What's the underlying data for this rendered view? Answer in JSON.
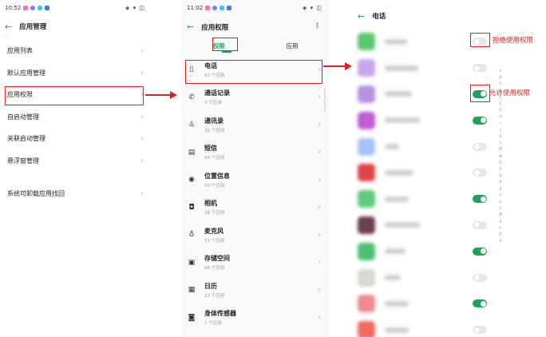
{
  "panel1": {
    "status": {
      "time": "10:52",
      "right": "◈ ▾ ◫"
    },
    "title": "应用管理",
    "menu": [
      {
        "label": "应用列表"
      },
      {
        "label": "默认应用管理"
      },
      {
        "label": "应用权限"
      },
      {
        "label": "自启动管理"
      },
      {
        "label": "关联启动管理"
      },
      {
        "label": "悬浮窗管理"
      },
      {
        "label": "系统可卸载应用找回"
      }
    ]
  },
  "panel2": {
    "status": {
      "time": "11:02",
      "right": "◈ ▾ ◫"
    },
    "title": "应用权限",
    "tabs": [
      "权限",
      "应用"
    ],
    "permissions": [
      {
        "label": "电话",
        "count": "52 个应用",
        "icon": "phone-icon"
      },
      {
        "label": "通话记录",
        "count": "3 个应用",
        "icon": "call-log-icon"
      },
      {
        "label": "通讯录",
        "count": "35 个应用",
        "icon": "contacts-icon"
      },
      {
        "label": "短信",
        "count": "54 个应用",
        "icon": "message-icon"
      },
      {
        "label": "位置信息",
        "count": "50 个应用",
        "icon": "location-icon"
      },
      {
        "label": "相机",
        "count": "38 个应用",
        "icon": "camera-icon"
      },
      {
        "label": "麦克风",
        "count": "31 个应用",
        "icon": "microphone-icon"
      },
      {
        "label": "存储空间",
        "count": "66 个应用",
        "icon": "storage-icon"
      },
      {
        "label": "日历",
        "count": "23 个应用",
        "icon": "calendar-icon"
      },
      {
        "label": "身体传感器",
        "count": "1 个应用",
        "icon": "sensor-icon"
      }
    ]
  },
  "panel3": {
    "title": "电话",
    "annotations": {
      "deny": "拒绝使用权限",
      "allow": "允许使用权限"
    },
    "index_letters": [
      "A",
      "B",
      "C",
      "D",
      "E",
      "F",
      "G",
      "H",
      "I",
      "J",
      "K",
      "L",
      "M",
      "N",
      "O",
      "P",
      "Q",
      "R",
      "S",
      "T",
      "U",
      "V",
      "W",
      "X",
      "Y",
      "Z",
      "#"
    ],
    "apps": [
      {
        "color": "#5cc86a",
        "enabled": false
      },
      {
        "color": "#c7a6ec",
        "enabled": false
      },
      {
        "color": "#b693e4",
        "enabled": true
      },
      {
        "color": "#c15bd8",
        "enabled": true
      },
      {
        "color": "#a9c2f6",
        "enabled": false
      },
      {
        "color": "#e0444a",
        "enabled": false
      },
      {
        "color": "#5fcb7f",
        "enabled": true
      },
      {
        "color": "#6b3f4e",
        "enabled": false
      },
      {
        "color": "#4fbf74",
        "enabled": true
      },
      {
        "color": "#d8d8d0",
        "enabled": false
      },
      {
        "color": "#ec8b91",
        "enabled": true
      },
      {
        "color": "#ef6a5f",
        "enabled": false
      }
    ]
  },
  "colors": {
    "accent": "#1fa25a",
    "highlight": "#e0201e"
  }
}
